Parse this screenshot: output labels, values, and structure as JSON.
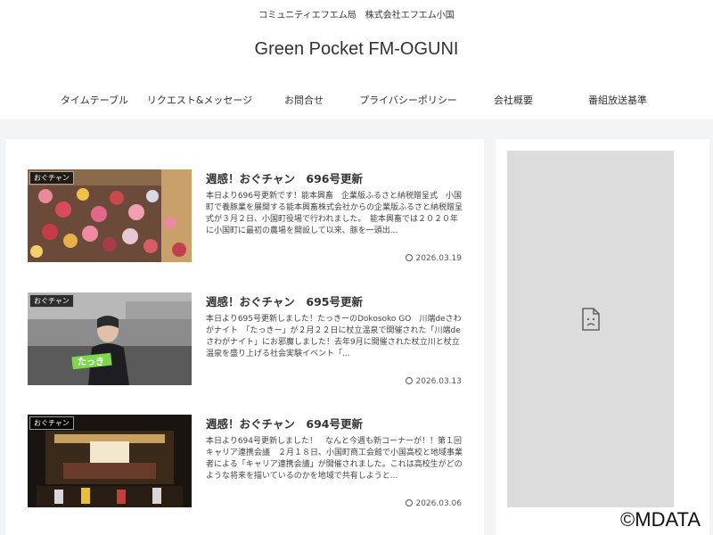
{
  "header": {
    "tagline": "コミュニティエフエム局　株式会社エフエム小国",
    "title": "Green Pocket FM-OGUNI"
  },
  "nav": [
    {
      "label": "タイムテーブル"
    },
    {
      "label": "リクエスト&メッセージ"
    },
    {
      "label": "お問合せ"
    },
    {
      "label": "プライバシーポリシー"
    },
    {
      "label": "会社概要"
    },
    {
      "label": "番組放送基準"
    }
  ],
  "posts": [
    {
      "category": "おぐチャン",
      "title": "週感！おぐチャン　696号更新",
      "excerpt": "本日より696号更新です！能本興畜　企業版ふるさと納税贈呈式　小国町で養豚業を展開する能本興畜株式会社からの企業版ふるさと納税贈呈式が３月２日、小国町役場で行われました。　能本興畜では２０２０年に小国町に最初の農場を開設して以来、豚を一頭出...",
      "date": "2026.03.19"
    },
    {
      "category": "おぐチャン",
      "title": "週感！おぐチャン　695号更新",
      "excerpt": "本日より695号更新しました！たっきーのDokosoko GO　川端deさわがナイト　「たっきー」が２月２２日に杖立温泉で開催された「川端deさわがナイト」にお邪魔しました！去年9月に開催された杖立川と杖立温泉を盛り上げる社会実験イベント「...",
      "date": "2026.03.13"
    },
    {
      "category": "おぐチャン",
      "title": "週感！おぐチャン　694号更新",
      "excerpt": "本日より694号更新しました！　なんと今週も新コーナーが！！第１回キャリア連携会議　２月１８日、小国町商工会館で小国高校と地域事業者による「キャリア連携会議」が開催されました。これは高校生がどのような将来を描いているのかを地域で共有しようと...",
      "date": "2026.03.06"
    }
  ],
  "watermark": "©MDATA"
}
